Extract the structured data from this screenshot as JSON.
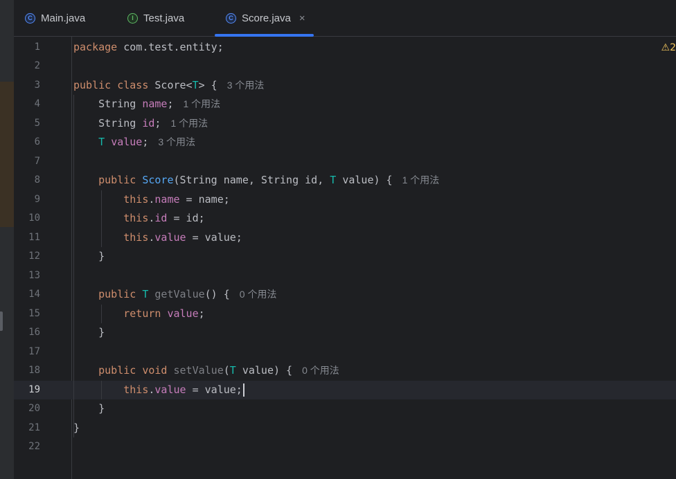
{
  "tabs": [
    {
      "label": "Main.java",
      "icon": "class-icon",
      "active": false
    },
    {
      "label": "Test.java",
      "icon": "interface-icon",
      "active": false
    },
    {
      "label": "Score.java",
      "icon": "class-icon",
      "active": true
    }
  ],
  "tab_icon_letters": {
    "class": "C",
    "interface": "I"
  },
  "close_glyph": "×",
  "warning_glyph": "⚠",
  "warning_count": "2",
  "editor": {
    "current_line": 19,
    "lines": [
      {
        "num": "1",
        "tokens": [
          [
            "kw",
            "package "
          ],
          [
            "",
            "com.test.entity;"
          ]
        ]
      },
      {
        "num": "2",
        "tokens": []
      },
      {
        "num": "3",
        "tokens": [
          [
            "kw",
            "public class "
          ],
          [
            "",
            "Score<"
          ],
          [
            "tp",
            "T"
          ],
          [
            "",
            "> {"
          ]
        ],
        "hint": "3 个用法"
      },
      {
        "num": "4",
        "tokens": [
          [
            "",
            "    String "
          ],
          [
            "fld",
            "name"
          ],
          [
            "",
            ";"
          ]
        ],
        "hint": "1 个用法"
      },
      {
        "num": "5",
        "tokens": [
          [
            "",
            "    String "
          ],
          [
            "fld",
            "id"
          ],
          [
            "",
            ";"
          ]
        ],
        "hint": "1 个用法"
      },
      {
        "num": "6",
        "tokens": [
          [
            "tp",
            "    T "
          ],
          [
            "fld",
            "value"
          ],
          [
            "",
            ";"
          ]
        ],
        "hint": "3 个用法"
      },
      {
        "num": "7",
        "tokens": []
      },
      {
        "num": "8",
        "tokens": [
          [
            "kw",
            "    public "
          ],
          [
            "fn",
            "Score"
          ],
          [
            "",
            "(String name, String id, "
          ],
          [
            "tp",
            "T"
          ],
          [
            "",
            " value) {"
          ]
        ],
        "hint": "1 个用法"
      },
      {
        "num": "9",
        "tokens": [
          [
            "kw",
            "        this"
          ],
          [
            "",
            "."
          ],
          [
            "fld",
            "name"
          ],
          [
            "",
            " = name;"
          ]
        ]
      },
      {
        "num": "10",
        "tokens": [
          [
            "kw",
            "        this"
          ],
          [
            "",
            "."
          ],
          [
            "fld",
            "id"
          ],
          [
            "",
            " = id;"
          ]
        ]
      },
      {
        "num": "11",
        "tokens": [
          [
            "kw",
            "        this"
          ],
          [
            "",
            "."
          ],
          [
            "fld",
            "value"
          ],
          [
            "",
            " = value;"
          ]
        ]
      },
      {
        "num": "12",
        "tokens": [
          [
            "",
            "    }"
          ]
        ]
      },
      {
        "num": "13",
        "tokens": []
      },
      {
        "num": "14",
        "tokens": [
          [
            "kw",
            "    public "
          ],
          [
            "tp",
            "T "
          ],
          [
            "mth",
            "getValue"
          ],
          [
            "",
            "() {"
          ]
        ],
        "hint": "0 个用法"
      },
      {
        "num": "15",
        "tokens": [
          [
            "kw",
            "        return "
          ],
          [
            "fld",
            "value"
          ],
          [
            "",
            ";"
          ]
        ]
      },
      {
        "num": "16",
        "tokens": [
          [
            "",
            "    }"
          ]
        ]
      },
      {
        "num": "17",
        "tokens": []
      },
      {
        "num": "18",
        "tokens": [
          [
            "kw",
            "    public void "
          ],
          [
            "mth",
            "setValue"
          ],
          [
            "",
            "("
          ],
          [
            "tp",
            "T"
          ],
          [
            "",
            " value) {"
          ]
        ],
        "hint": "0 个用法"
      },
      {
        "num": "19",
        "tokens": [
          [
            "kw",
            "        this"
          ],
          [
            "",
            "."
          ],
          [
            "fld",
            "value"
          ],
          [
            "",
            " = value;"
          ]
        ],
        "caret": true
      },
      {
        "num": "20",
        "tokens": [
          [
            "",
            "    }"
          ]
        ]
      },
      {
        "num": "21",
        "tokens": [
          [
            "",
            "}"
          ]
        ]
      },
      {
        "num": "22",
        "tokens": []
      }
    ]
  }
}
